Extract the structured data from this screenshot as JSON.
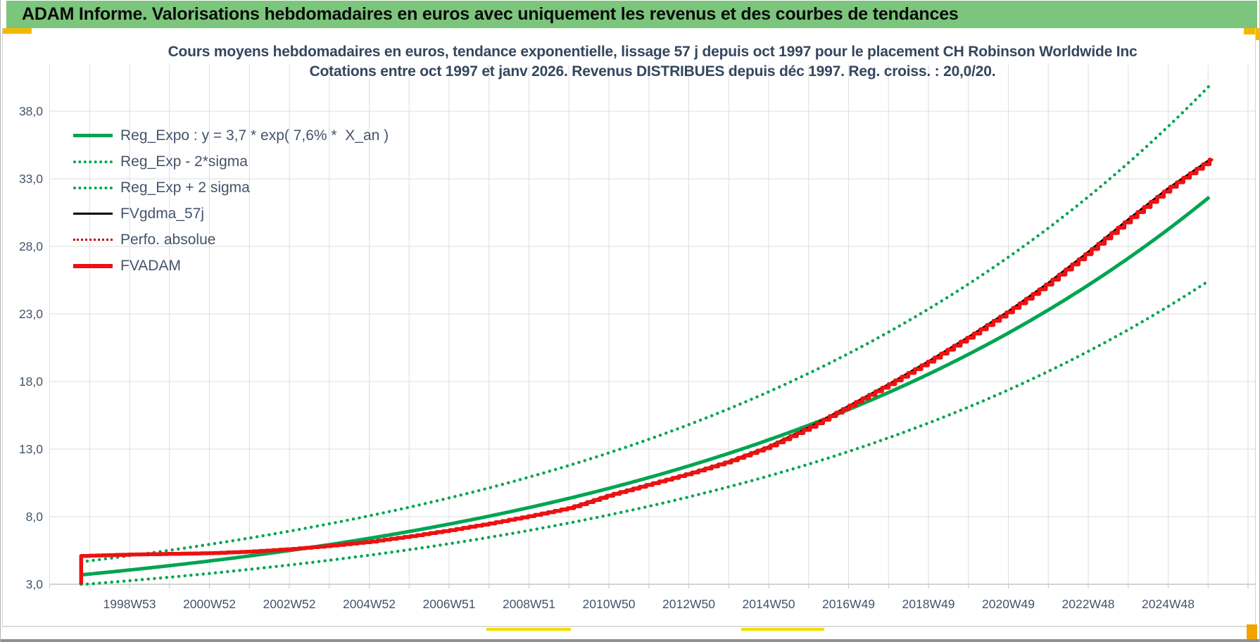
{
  "window": {
    "title": "ADAM Informe. Valorisations hebdomadaires en euros avec uniquement les revenus et des courbes de tendances"
  },
  "colors": {
    "header_bg": "#7CC57C",
    "accent_yellow": "#F5B800",
    "trend_green": "#00A551",
    "series_red": "#ED1111",
    "perf_red": "#C00000",
    "series_black": "#000000",
    "axis_text": "#44546A",
    "title_text": "#33475E",
    "gridline": "#DEDEDE"
  },
  "chart_data": {
    "type": "line",
    "title": "Cours moyens hebdomadaires en euros, tendance exponentielle, lissage 57 j depuis oct 1997 pour le placement CH Robinson Worldwide Inc",
    "subtitle": "Cotations entre oct 1997 et janv 2026. Revenus DISTRIBUES depuis déc 1997. Reg. croiss. : 20,0/20.",
    "legend_position": "top-left",
    "grid": true,
    "x_axis": {
      "tick_labels": [
        "1998W53",
        "2000W52",
        "2002W52",
        "2004W52",
        "2006W51",
        "2008W51",
        "2010W50",
        "2012W50",
        "2014W50",
        "2016W49",
        "2018W49",
        "2020W49",
        "2022W48",
        "2024W48"
      ],
      "tick_years": [
        1999,
        2001,
        2003,
        2005,
        2007,
        2009,
        2011,
        2013,
        2015,
        2017,
        2019,
        2021,
        2023,
        2025
      ],
      "gridline_years": [
        1997,
        2027,
        1
      ],
      "range_years": [
        1997.0,
        2027.0
      ]
    },
    "y_axis": {
      "tick_labels": [
        "3,0",
        "8,0",
        "13,0",
        "18,0",
        "23,0",
        "28,0",
        "33,0",
        "38,0"
      ],
      "tick_values": [
        3,
        8,
        13,
        18,
        23,
        28,
        33,
        38
      ],
      "range": [
        3.0,
        40.5
      ]
    },
    "x_start": 1997.79,
    "x_end": 2026.08,
    "series": [
      {
        "name": "Reg_Expo : y = 3,7 * exp( 7,6% *  X_an )",
        "type": "exponential",
        "a": 3.7,
        "rate": 0.076,
        "factor": 1.0,
        "color": "#00A551",
        "style": "solid"
      },
      {
        "name": "Reg_Exp - 2*sigma",
        "type": "exponential",
        "a": 3.7,
        "rate": 0.076,
        "factor": 0.805,
        "color": "#00A551",
        "style": "dotted"
      },
      {
        "name": "Reg_Exp + 2 sigma",
        "type": "exponential",
        "a": 3.7,
        "rate": 0.076,
        "factor": 1.26,
        "color": "#00A551",
        "style": "dotted"
      },
      {
        "name": "FVgdma_57j",
        "type": "anchors",
        "points_ref": 5,
        "skip_first": true,
        "color": "#000000",
        "style": "solid"
      },
      {
        "name": "Perfo. absolue",
        "type": "anchors",
        "points_ref": 5,
        "skip_first": true,
        "color": "#C00000",
        "style": "dotted"
      },
      {
        "name": "FVADAM",
        "type": "anchors",
        "points": [
          [
            1997.79,
            3.0
          ],
          [
            1997.83,
            5.1
          ],
          [
            1999.0,
            5.2
          ],
          [
            2000.0,
            5.25
          ],
          [
            2001.0,
            5.3
          ],
          [
            2002.0,
            5.42
          ],
          [
            2003.0,
            5.6
          ],
          [
            2004.0,
            5.85
          ],
          [
            2005.0,
            6.15
          ],
          [
            2006.0,
            6.55
          ],
          [
            2007.0,
            7.0
          ],
          [
            2008.0,
            7.5
          ],
          [
            2009.0,
            8.05
          ],
          [
            2010.0,
            8.65
          ],
          [
            2011.0,
            9.6
          ],
          [
            2012.0,
            10.4
          ],
          [
            2013.0,
            11.2
          ],
          [
            2014.0,
            12.1
          ],
          [
            2015.0,
            13.2
          ],
          [
            2016.0,
            14.6
          ],
          [
            2017.0,
            16.2
          ],
          [
            2018.0,
            17.8
          ],
          [
            2019.0,
            19.5
          ],
          [
            2020.0,
            21.3
          ],
          [
            2021.0,
            23.2
          ],
          [
            2022.0,
            25.3
          ],
          [
            2023.0,
            27.6
          ],
          [
            2024.0,
            30.0
          ],
          [
            2025.0,
            32.3
          ],
          [
            2026.08,
            34.5
          ]
        ],
        "color": "#ED1111",
        "style": "stepped"
      }
    ]
  }
}
